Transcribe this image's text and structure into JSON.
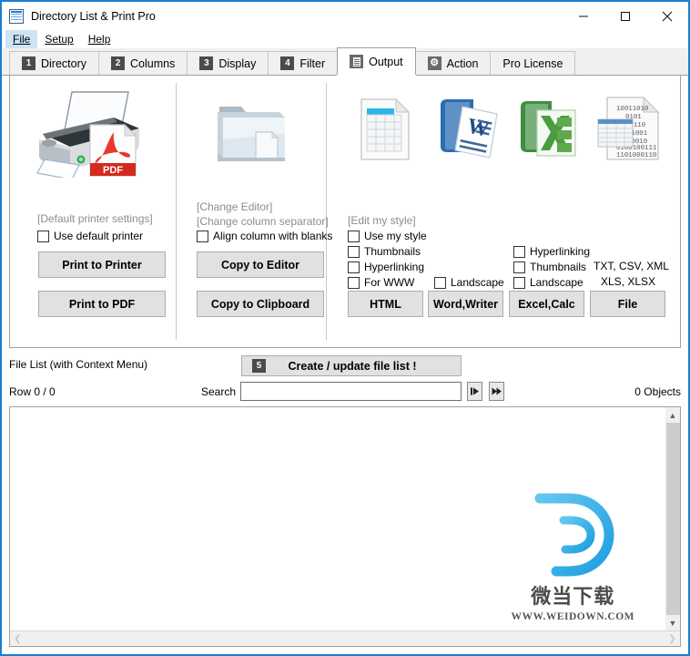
{
  "window": {
    "title": "Directory List & Print Pro",
    "icon": "app-list-icon",
    "minimize": "–",
    "maximize": "□",
    "close": "✕"
  },
  "menu": {
    "items": [
      {
        "label": "File",
        "selected": true
      },
      {
        "label": "Setup",
        "selected": false
      },
      {
        "label": "Help",
        "selected": false
      }
    ]
  },
  "tabs": [
    {
      "badge": "1",
      "label": "Directory",
      "active": false,
      "icon": ""
    },
    {
      "badge": "2",
      "label": "Columns",
      "active": false,
      "icon": ""
    },
    {
      "badge": "3",
      "label": "Display",
      "active": false,
      "icon": ""
    },
    {
      "badge": "4",
      "label": "Filter",
      "active": false,
      "icon": ""
    },
    {
      "badge": "",
      "label": "Output",
      "active": true,
      "icon": "document-icon"
    },
    {
      "badge": "",
      "label": "Action",
      "active": false,
      "icon": "gear-icon"
    },
    {
      "badge": "",
      "label": "Pro License",
      "active": false,
      "icon": ""
    }
  ],
  "output": {
    "printer_section": {
      "icon": "printer-pdf-icon",
      "link_label": "[Default printer settings]",
      "checkbox_label": "Use default printer",
      "button_primary": "Print to Printer",
      "button_secondary": "Print to PDF"
    },
    "editor_section": {
      "icon": "folder-document-icon",
      "link_label_1": "[Change Editor]",
      "link_label_2": "[Change column separator]",
      "checkbox_label": "Align column with blanks",
      "button_primary": "Copy to Editor",
      "button_secondary": "Copy to Clipboard"
    },
    "html_section": {
      "icon": "html-table-icon",
      "link_label": "[Edit my style]",
      "checkboxes": [
        "Use my style",
        "Thumbnails",
        "Hyperlinking",
        "For WWW"
      ],
      "button": "HTML"
    },
    "word_section": {
      "icon": "word-icon",
      "checkboxes": [
        "Landscape"
      ],
      "button": "Word,Writer"
    },
    "excel_section": {
      "icon": "excel-icon",
      "checkboxes": [
        "Hyperlinking",
        "Thumbnails",
        "Landscape"
      ],
      "button": "Excel,Calc"
    },
    "file_section": {
      "icon": "binary-file-icon",
      "formats_line_1": "TXT, CSV, XML",
      "formats_line_2": "XLS, XLSX",
      "button": "File"
    }
  },
  "filelist": {
    "caption": "File List (with Context Menu)",
    "create_button": {
      "badge": "5",
      "label": "Create / update file list !"
    },
    "row_status": "Row 0 / 0",
    "search_label": "Search",
    "search_value": "",
    "search_placeholder": "",
    "nav_next_icon": "find-next-icon",
    "nav_all_icon": "find-all-icon",
    "object_count": "0 Objects"
  },
  "watermark": {
    "logo": "letter-d-logo",
    "chinese_text": "微当下载",
    "url_text": "WWW.WEIDOWN.COM"
  },
  "colors": {
    "window_border": "#1a7fd4",
    "menu_selected": "#cce4f7",
    "button_face": "#e1e1e1",
    "tab_inactive": "#f0f0f0",
    "badge_dark": "#4b4b4b",
    "gray_label": "#8d8d8d",
    "watermark_blue": "#2fa8e8"
  }
}
